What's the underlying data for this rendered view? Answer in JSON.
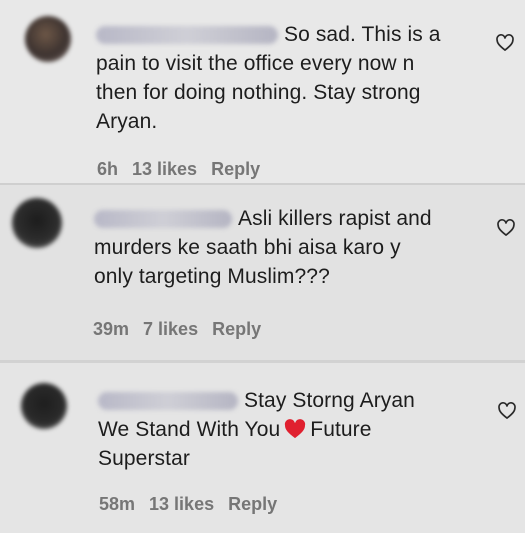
{
  "comments": [
    {
      "text_line1": "So sad. This is a",
      "text_line2": "pain to visit the office every now n",
      "text_line3": "then for doing nothing. Stay strong",
      "text_line4": "Aryan.",
      "time": "6h",
      "likes": "13 likes",
      "reply": "Reply"
    },
    {
      "text_line1": "Asli killers rapist and",
      "text_line2": "murders ke saath bhi aisa karo y",
      "text_line3": "only targeting Muslim???",
      "time": "39m",
      "likes": "7 likes",
      "reply": "Reply"
    },
    {
      "text_line1": "Stay Storng Aryan",
      "text_line2a": "We Stand With You",
      "text_line2b": "Future",
      "text_line3": "Superstar",
      "time": "58m",
      "likes": "13 likes",
      "reply": "Reply"
    }
  ],
  "icons": {
    "like": "heart-outline-icon",
    "emoji": "red-heart-emoji"
  },
  "colors": {
    "text": "#1d1d1d",
    "meta": "#767676",
    "heart_emoji": "#e0202f"
  }
}
